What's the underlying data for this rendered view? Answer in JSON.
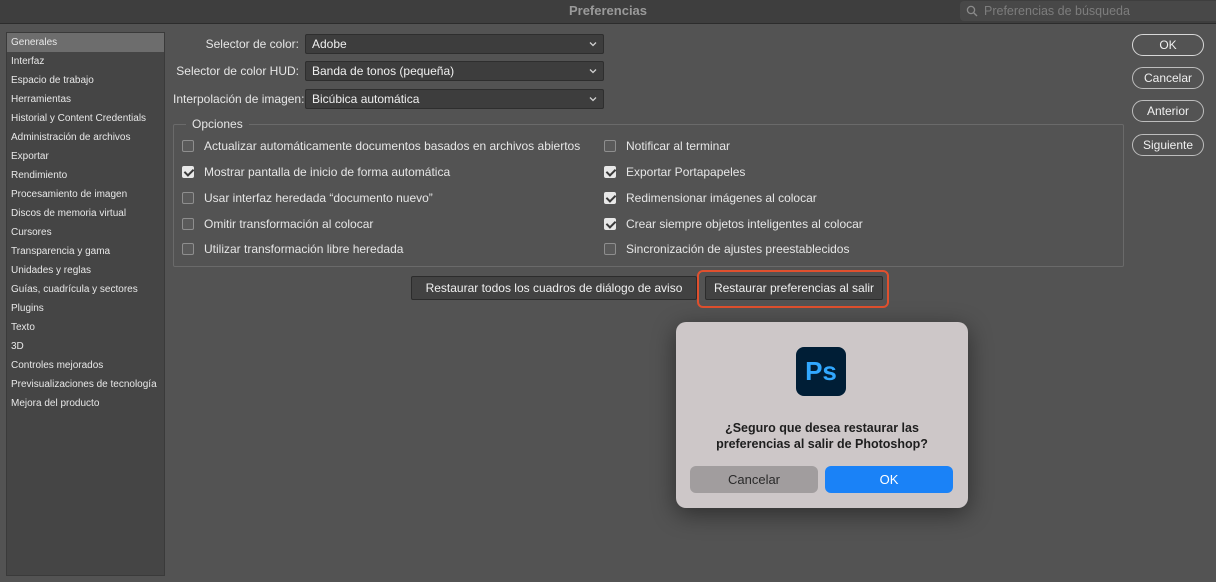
{
  "window": {
    "title": "Preferencias"
  },
  "search": {
    "placeholder": "Preferencias de búsqueda"
  },
  "sidebar": {
    "items": [
      "Generales",
      "Interfaz",
      "Espacio de trabajo",
      "Herramientas",
      "Historial y Content Credentials",
      "Administración de archivos",
      "Exportar",
      "Rendimiento",
      "Procesamiento de imagen",
      "Discos de memoria virtual",
      "Cursores",
      "Transparencia y gama",
      "Unidades y reglas",
      "Guías, cuadrícula y sectores",
      "Plugins",
      "Texto",
      "3D",
      "Controles mejorados",
      "Previsualizaciones de tecnología",
      "Mejora del producto"
    ],
    "selected": "Generales"
  },
  "fields": {
    "color_picker": {
      "label": "Selector de color:",
      "value": "Adobe"
    },
    "hud_picker": {
      "label": "Selector de color HUD:",
      "value": "Banda de tonos (pequeña)"
    },
    "interpolation": {
      "label": "Interpolación de imagen:",
      "value": "Bicúbica automática"
    }
  },
  "options": {
    "legend": "Opciones",
    "left": [
      {
        "label": "Actualizar automáticamente documentos basados en archivos abiertos",
        "checked": false
      },
      {
        "label": "Mostrar pantalla de inicio de forma automática",
        "checked": true
      },
      {
        "label": "Usar interfaz heredada “documento nuevo”",
        "checked": false
      },
      {
        "label": "Omitir transformación al colocar",
        "checked": false
      },
      {
        "label": "Utilizar transformación libre heredada",
        "checked": false
      }
    ],
    "right": [
      {
        "label": "Notificar al terminar",
        "checked": false
      },
      {
        "label": "Exportar Portapapeles",
        "checked": true
      },
      {
        "label": "Redimensionar imágenes al colocar",
        "checked": true
      },
      {
        "label": "Crear siempre objetos inteligentes al colocar",
        "checked": true
      },
      {
        "label": "Sincronización de ajustes preestablecidos",
        "checked": false
      }
    ]
  },
  "actions": {
    "reset_dialogs": "Restaurar todos los cuadros de diálogo de aviso",
    "reset_prefs": "Restaurar preferencias al salir"
  },
  "right_buttons": {
    "ok": "OK",
    "cancel": "Cancelar",
    "prev": "Anterior",
    "next": "Siguiente"
  },
  "confirm_dialog": {
    "logo": "Ps",
    "message": "¿Seguro que desea restaurar las preferencias al salir de Photoshop?",
    "cancel": "Cancelar",
    "ok": "OK"
  },
  "colors": {
    "highlight": "#e0502e",
    "ok_blue": "#1a82f7",
    "ps_blue": "#31a8ff",
    "ps_bg": "#001e36"
  }
}
